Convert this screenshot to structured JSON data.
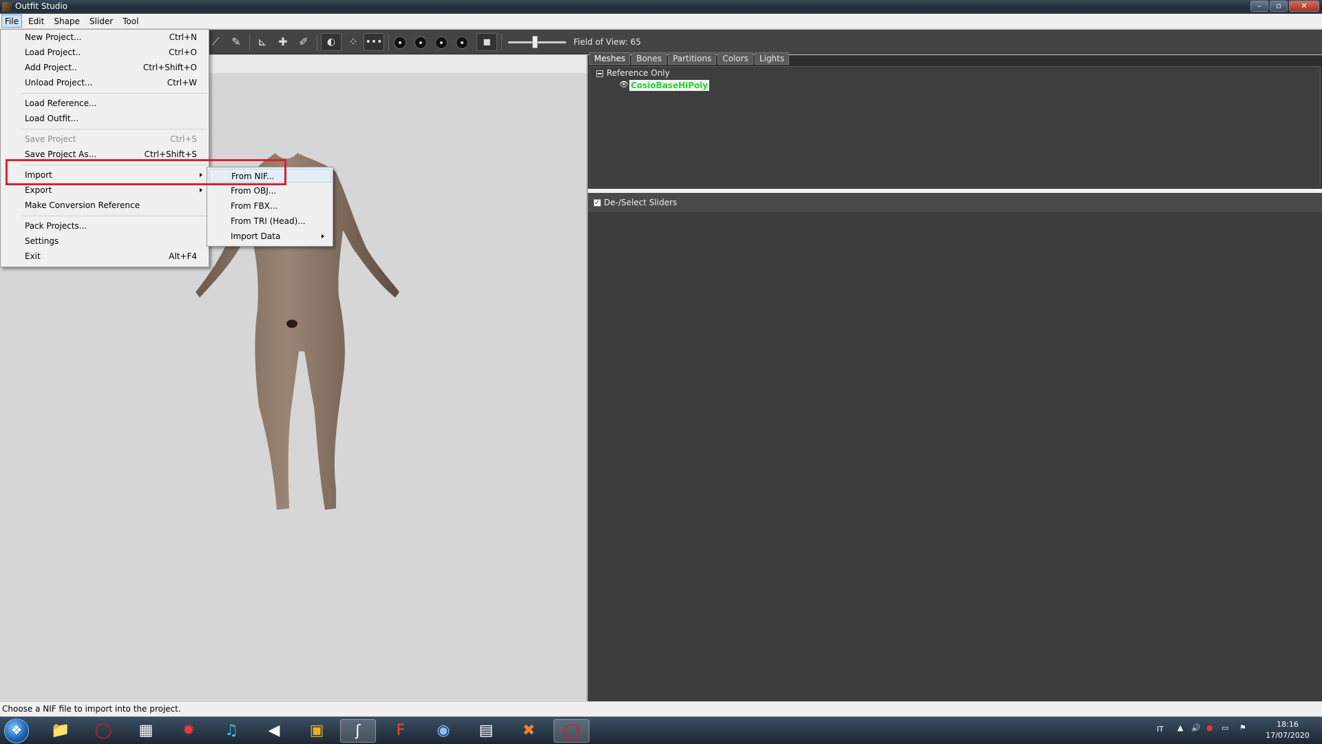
{
  "window": {
    "title": "Outfit Studio",
    "controls": [
      "minimize",
      "maximize",
      "close"
    ]
  },
  "menubar": {
    "items": [
      "File",
      "Edit",
      "Shape",
      "Slider",
      "Tool"
    ],
    "active": "File"
  },
  "toolbar": {
    "fov_label": "Field of View: 65",
    "fov_value": 65
  },
  "file_menu": {
    "items": [
      {
        "label": "New Project...",
        "shortcut": "Ctrl+N",
        "enabled": true
      },
      {
        "label": "Load Project..",
        "shortcut": "Ctrl+O",
        "enabled": true
      },
      {
        "label": "Add Project..",
        "shortcut": "Ctrl+Shift+O",
        "enabled": true
      },
      {
        "label": "Unload Project...",
        "shortcut": "Ctrl+W",
        "enabled": true
      },
      {
        "label": "Load Reference...",
        "shortcut": "",
        "enabled": true
      },
      {
        "label": "Load Outfit...",
        "shortcut": "",
        "enabled": true
      },
      {
        "label": "Save Project",
        "shortcut": "Ctrl+S",
        "enabled": false
      },
      {
        "label": "Save Project As...",
        "shortcut": "Ctrl+Shift+S",
        "enabled": true
      },
      {
        "label": "Import",
        "shortcut": "",
        "enabled": true,
        "submenu": true
      },
      {
        "label": "Export",
        "shortcut": "",
        "enabled": true,
        "submenu": true
      },
      {
        "label": "Make Conversion Reference",
        "shortcut": "",
        "enabled": true
      },
      {
        "label": "Pack Projects...",
        "shortcut": "",
        "enabled": true
      },
      {
        "label": "Settings",
        "shortcut": "",
        "enabled": true
      },
      {
        "label": "Exit",
        "shortcut": "Alt+F4",
        "enabled": true
      }
    ]
  },
  "import_submenu": {
    "items": [
      {
        "label": "From NIF...",
        "hovered": true
      },
      {
        "label": "From OBJ..."
      },
      {
        "label": "From FBX..."
      },
      {
        "label": "From TRI (Head)..."
      },
      {
        "label": "Import Data",
        "submenu": true
      }
    ]
  },
  "right_panel": {
    "tabs": [
      "Meshes",
      "Bones",
      "Partitions",
      "Colors",
      "Lights"
    ],
    "active_tab": "Meshes",
    "tree": {
      "root": "Reference Only",
      "child": "CosioBaseHiPoly"
    },
    "sliders_header": "De-/Select Sliders",
    "sliders_checked": true
  },
  "status": {
    "text": "Choose a NIF file to import into the project."
  },
  "taskbar": {
    "apps": [
      "file-explorer",
      "opera",
      "media-center",
      "antivirus",
      "music-app",
      "volume-tool",
      "archive-app",
      "outfit-studio",
      "foxit",
      "ffdec",
      "notepad",
      "tools-app",
      "opera"
    ],
    "language": "IT",
    "time": "18:16",
    "date": "17/07/2020"
  },
  "colors": {
    "highlight": "#d9222c",
    "mesh_label": "#20d82a",
    "panel_bg": "#3d3d3d"
  }
}
